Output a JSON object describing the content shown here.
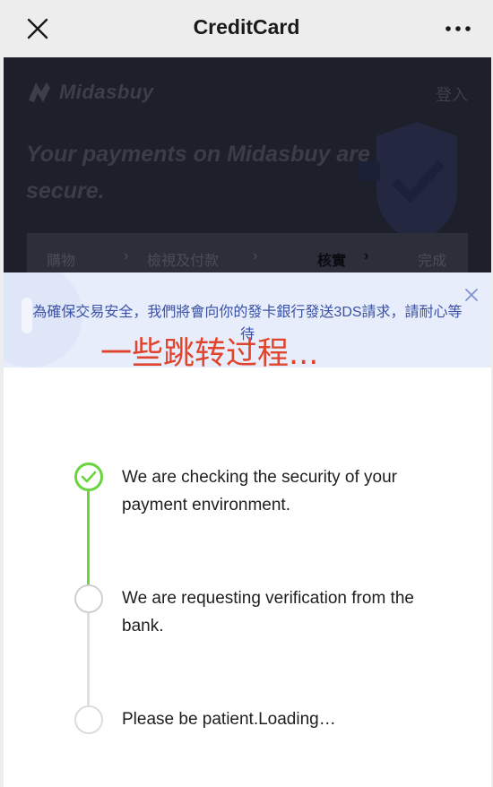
{
  "navbar": {
    "title": "CreditCard",
    "close_icon": "close-icon",
    "more_icon": "more-horizontal-icon"
  },
  "page": {
    "brand": "Midasbuy",
    "login": "登入",
    "hero_text": "Your payments on Midasbuy are secure.",
    "steps": [
      {
        "label": "購物"
      },
      {
        "label": "檢視及付款"
      },
      {
        "label": "核實"
      },
      {
        "label": "完成"
      }
    ],
    "current_step": "核實"
  },
  "notice": {
    "text": "為確保交易安全，我們將會向你的發卡銀行發送3DS請求，請耐心等待"
  },
  "overlay_title": "一些跳转过程...",
  "progress": [
    {
      "text": "We are checking the security of your payment environment.",
      "status": "done"
    },
    {
      "text": "We are requesting verification from the bank.",
      "status": "in-progress"
    },
    {
      "text": "Please be patient.Loading…",
      "status": "pending"
    }
  ],
  "colors": {
    "accent_green": "#6ad43c",
    "notice_text": "#3a52a6",
    "notice_bg": "#e8edfb",
    "overlay_red": "#e0442d",
    "hero_bg": "#1d1f2a"
  }
}
